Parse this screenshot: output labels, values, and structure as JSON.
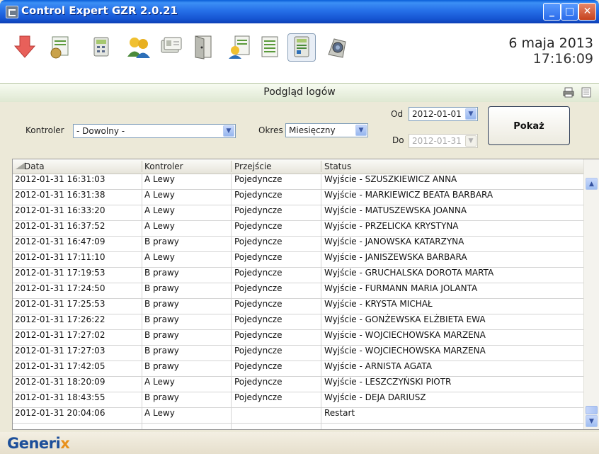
{
  "window": {
    "title": "Control Expert GZR 2.0.21"
  },
  "toolbar": {
    "icons": [
      "alarm-down-arrow-icon",
      "settings-tools-icon",
      "controller-keypad-icon",
      "users-group-icon",
      "id-cards-icon",
      "door-icon",
      "user-report-icon",
      "log-list-icon",
      "camera-icon"
    ],
    "active": "log-list-icon",
    "date": "6 maja 2013",
    "time": "17:16:09"
  },
  "section": {
    "title": "Podgląd logów"
  },
  "filters": {
    "kontroler_label": "Kontroler",
    "kontroler_value": "- Dowolny -",
    "okres_label": "Okres",
    "okres_value": "Miesięczny",
    "od_label": "Od",
    "od_value": "2012-01-01",
    "do_label": "Do",
    "do_value": "2012-01-31",
    "show_button": "Pokaż"
  },
  "table": {
    "columns": [
      "Data",
      "Kontroler",
      "Przejście",
      "Status"
    ],
    "rows": [
      [
        "2012-01-31 16:31:03",
        "A Lewy",
        "Pojedyncze",
        "Wyjście - SZUSZKIEWICZ ANNA"
      ],
      [
        "2012-01-31 16:31:38",
        "A Lewy",
        "Pojedyncze",
        "Wyjście - MARKIEWICZ BEATA BARBARA"
      ],
      [
        "2012-01-31 16:33:20",
        "A Lewy",
        "Pojedyncze",
        "Wyjście - MATUSZEWSKA JOANNA"
      ],
      [
        "2012-01-31 16:37:52",
        "A Lewy",
        "Pojedyncze",
        "Wyjście - PRZELICKA KRYSTYNA"
      ],
      [
        "2012-01-31 16:47:09",
        "B prawy",
        "Pojedyncze",
        "Wyjście - JANOWSKA KATARZYNA"
      ],
      [
        "2012-01-31 17:11:10",
        "A Lewy",
        "Pojedyncze",
        "Wyjście - JANISZEWSKA BARBARA"
      ],
      [
        "2012-01-31 17:19:53",
        "B prawy",
        "Pojedyncze",
        "Wyjście - GRUCHALSKA DOROTA MARTA"
      ],
      [
        "2012-01-31 17:24:50",
        "B prawy",
        "Pojedyncze",
        "Wyjście - FURMANN MARIA JOLANTA"
      ],
      [
        "2012-01-31 17:25:53",
        "B prawy",
        "Pojedyncze",
        "Wyjście - KRYSTA MICHAŁ"
      ],
      [
        "2012-01-31 17:26:22",
        "B prawy",
        "Pojedyncze",
        "Wyjście - GONŻEWSKA ELŻBIETA EWA"
      ],
      [
        "2012-01-31 17:27:02",
        "B prawy",
        "Pojedyncze",
        "Wyjście - WOJCIECHOWSKA MARZENA"
      ],
      [
        "2012-01-31 17:27:03",
        "B prawy",
        "Pojedyncze",
        "Wyjście - WOJCIECHOWSKA MARZENA"
      ],
      [
        "2012-01-31 17:42:05",
        "B prawy",
        "Pojedyncze",
        "Wyjście - ARNISTA AGATA"
      ],
      [
        "2012-01-31 18:20:09",
        "A Lewy",
        "Pojedyncze",
        "Wyjście - LESZCZYŃSKI PIOTR"
      ],
      [
        "2012-01-31 18:43:55",
        "B prawy",
        "Pojedyncze",
        "Wyjście - DEJA DARIUSZ"
      ],
      [
        "2012-01-31 20:04:06",
        "A Lewy",
        "",
        "Restart"
      ]
    ]
  },
  "footer": {
    "logo_main": "Generi",
    "logo_accent": "x"
  }
}
